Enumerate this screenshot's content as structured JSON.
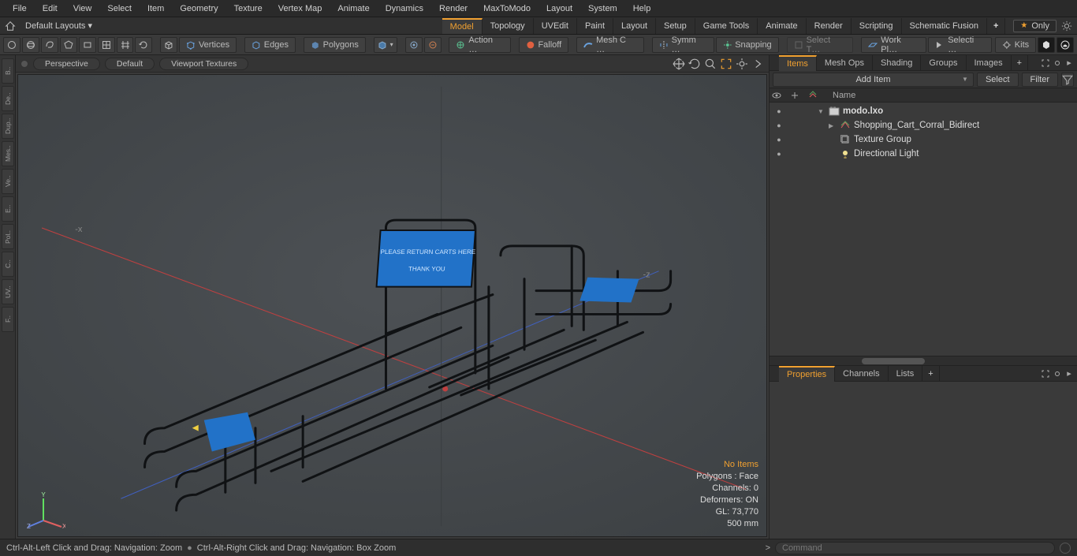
{
  "menubar": [
    "File",
    "Edit",
    "View",
    "Select",
    "Item",
    "Geometry",
    "Texture",
    "Vertex Map",
    "Animate",
    "Dynamics",
    "Render",
    "MaxToModo",
    "Layout",
    "System",
    "Help"
  ],
  "layout_label": "Default Layouts ▾",
  "only_label": "Only",
  "main_tabs": [
    {
      "label": "Model",
      "active": true
    },
    {
      "label": "Topology"
    },
    {
      "label": "UVEdit"
    },
    {
      "label": "Paint"
    },
    {
      "label": "Layout"
    },
    {
      "label": "Setup"
    },
    {
      "label": "Game Tools"
    },
    {
      "label": "Animate"
    },
    {
      "label": "Render"
    },
    {
      "label": "Scripting"
    },
    {
      "label": "Schematic Fusion"
    }
  ],
  "toolbar": {
    "vertices": "Vertices",
    "edges": "Edges",
    "polygons": "Polygons",
    "action": "Action  …",
    "falloff": "Falloff",
    "meshc": "Mesh C …",
    "symm": "Symm …",
    "snapping": "Snapping",
    "selectt": "Select T…",
    "workpl": "Work Pl…",
    "selecti": "Selecti …",
    "kits": "Kits"
  },
  "left_tabs": [
    "B..",
    "De..",
    "Dup..",
    "Mes..",
    "Ve..",
    "E..",
    "Pol..",
    "C..",
    "UV..",
    "F.."
  ],
  "viewport": {
    "tabs": [
      "Perspective",
      "Default",
      "Viewport Textures"
    ],
    "overlay": {
      "noitems": "No Items",
      "polymode": "Polygons : Face",
      "channels": "Channels: 0",
      "deformers": "Deformers: ON",
      "gl": "GL: 73,770",
      "len": "500 mm"
    },
    "axis_x": "-x",
    "axis_z": "-z",
    "axis_y": "Y",
    "axis_xx": "X",
    "axis_zz": "Z",
    "sign_line1": "PLEASE RETURN CARTS HERE",
    "sign_line2": "THANK YOU"
  },
  "items_panel": {
    "tabs": [
      {
        "label": "Items",
        "active": true
      },
      {
        "label": "Mesh Ops"
      },
      {
        "label": "Shading"
      },
      {
        "label": "Groups"
      },
      {
        "label": "Images"
      }
    ],
    "add": "Add Item",
    "select": "Select",
    "filter": "Filter",
    "name_header": "Name",
    "tree": [
      {
        "label": "modo.lxo",
        "bold": true,
        "icon": "scene",
        "indent": 0,
        "arrow": "▼"
      },
      {
        "label": "Shopping_Cart_Corral_Bidirect",
        "icon": "mesh",
        "indent": 1,
        "arrow": "▶"
      },
      {
        "label": "Texture Group",
        "icon": "group",
        "indent": 1,
        "arrow": ""
      },
      {
        "label": "Directional Light",
        "icon": "light",
        "indent": 1,
        "arrow": ""
      }
    ]
  },
  "props_panel": {
    "tabs": [
      {
        "label": "Properties",
        "active": true
      },
      {
        "label": "Channels"
      },
      {
        "label": "Lists"
      }
    ]
  },
  "status": {
    "left1": "Ctrl-Alt-Left Click and Drag: Navigation: Zoom",
    "left2": "Ctrl-Alt-Right Click and Drag: Navigation: Box Zoom",
    "cmd_placeholder": "Command"
  }
}
